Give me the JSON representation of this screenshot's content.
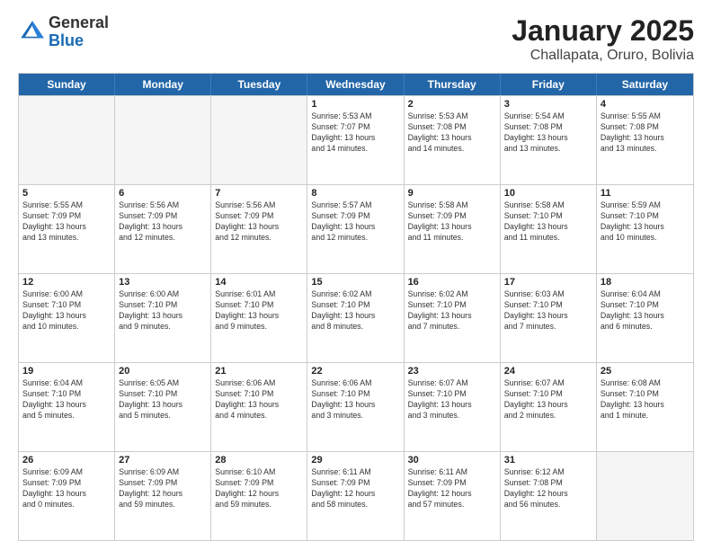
{
  "logo": {
    "general": "General",
    "blue": "Blue"
  },
  "title": "January 2025",
  "location": "Challapata, Oruro, Bolivia",
  "days": [
    "Sunday",
    "Monday",
    "Tuesday",
    "Wednesday",
    "Thursday",
    "Friday",
    "Saturday"
  ],
  "weeks": [
    [
      {
        "day": "",
        "info": ""
      },
      {
        "day": "",
        "info": ""
      },
      {
        "day": "",
        "info": ""
      },
      {
        "day": "1",
        "info": "Sunrise: 5:53 AM\nSunset: 7:07 PM\nDaylight: 13 hours\nand 14 minutes."
      },
      {
        "day": "2",
        "info": "Sunrise: 5:53 AM\nSunset: 7:08 PM\nDaylight: 13 hours\nand 14 minutes."
      },
      {
        "day": "3",
        "info": "Sunrise: 5:54 AM\nSunset: 7:08 PM\nDaylight: 13 hours\nand 13 minutes."
      },
      {
        "day": "4",
        "info": "Sunrise: 5:55 AM\nSunset: 7:08 PM\nDaylight: 13 hours\nand 13 minutes."
      }
    ],
    [
      {
        "day": "5",
        "info": "Sunrise: 5:55 AM\nSunset: 7:09 PM\nDaylight: 13 hours\nand 13 minutes."
      },
      {
        "day": "6",
        "info": "Sunrise: 5:56 AM\nSunset: 7:09 PM\nDaylight: 13 hours\nand 12 minutes."
      },
      {
        "day": "7",
        "info": "Sunrise: 5:56 AM\nSunset: 7:09 PM\nDaylight: 13 hours\nand 12 minutes."
      },
      {
        "day": "8",
        "info": "Sunrise: 5:57 AM\nSunset: 7:09 PM\nDaylight: 13 hours\nand 12 minutes."
      },
      {
        "day": "9",
        "info": "Sunrise: 5:58 AM\nSunset: 7:09 PM\nDaylight: 13 hours\nand 11 minutes."
      },
      {
        "day": "10",
        "info": "Sunrise: 5:58 AM\nSunset: 7:10 PM\nDaylight: 13 hours\nand 11 minutes."
      },
      {
        "day": "11",
        "info": "Sunrise: 5:59 AM\nSunset: 7:10 PM\nDaylight: 13 hours\nand 10 minutes."
      }
    ],
    [
      {
        "day": "12",
        "info": "Sunrise: 6:00 AM\nSunset: 7:10 PM\nDaylight: 13 hours\nand 10 minutes."
      },
      {
        "day": "13",
        "info": "Sunrise: 6:00 AM\nSunset: 7:10 PM\nDaylight: 13 hours\nand 9 minutes."
      },
      {
        "day": "14",
        "info": "Sunrise: 6:01 AM\nSunset: 7:10 PM\nDaylight: 13 hours\nand 9 minutes."
      },
      {
        "day": "15",
        "info": "Sunrise: 6:02 AM\nSunset: 7:10 PM\nDaylight: 13 hours\nand 8 minutes."
      },
      {
        "day": "16",
        "info": "Sunrise: 6:02 AM\nSunset: 7:10 PM\nDaylight: 13 hours\nand 7 minutes."
      },
      {
        "day": "17",
        "info": "Sunrise: 6:03 AM\nSunset: 7:10 PM\nDaylight: 13 hours\nand 7 minutes."
      },
      {
        "day": "18",
        "info": "Sunrise: 6:04 AM\nSunset: 7:10 PM\nDaylight: 13 hours\nand 6 minutes."
      }
    ],
    [
      {
        "day": "19",
        "info": "Sunrise: 6:04 AM\nSunset: 7:10 PM\nDaylight: 13 hours\nand 5 minutes."
      },
      {
        "day": "20",
        "info": "Sunrise: 6:05 AM\nSunset: 7:10 PM\nDaylight: 13 hours\nand 5 minutes."
      },
      {
        "day": "21",
        "info": "Sunrise: 6:06 AM\nSunset: 7:10 PM\nDaylight: 13 hours\nand 4 minutes."
      },
      {
        "day": "22",
        "info": "Sunrise: 6:06 AM\nSunset: 7:10 PM\nDaylight: 13 hours\nand 3 minutes."
      },
      {
        "day": "23",
        "info": "Sunrise: 6:07 AM\nSunset: 7:10 PM\nDaylight: 13 hours\nand 3 minutes."
      },
      {
        "day": "24",
        "info": "Sunrise: 6:07 AM\nSunset: 7:10 PM\nDaylight: 13 hours\nand 2 minutes."
      },
      {
        "day": "25",
        "info": "Sunrise: 6:08 AM\nSunset: 7:10 PM\nDaylight: 13 hours\nand 1 minute."
      }
    ],
    [
      {
        "day": "26",
        "info": "Sunrise: 6:09 AM\nSunset: 7:09 PM\nDaylight: 13 hours\nand 0 minutes."
      },
      {
        "day": "27",
        "info": "Sunrise: 6:09 AM\nSunset: 7:09 PM\nDaylight: 12 hours\nand 59 minutes."
      },
      {
        "day": "28",
        "info": "Sunrise: 6:10 AM\nSunset: 7:09 PM\nDaylight: 12 hours\nand 59 minutes."
      },
      {
        "day": "29",
        "info": "Sunrise: 6:11 AM\nSunset: 7:09 PM\nDaylight: 12 hours\nand 58 minutes."
      },
      {
        "day": "30",
        "info": "Sunrise: 6:11 AM\nSunset: 7:09 PM\nDaylight: 12 hours\nand 57 minutes."
      },
      {
        "day": "31",
        "info": "Sunrise: 6:12 AM\nSunset: 7:08 PM\nDaylight: 12 hours\nand 56 minutes."
      },
      {
        "day": "",
        "info": ""
      }
    ]
  ]
}
